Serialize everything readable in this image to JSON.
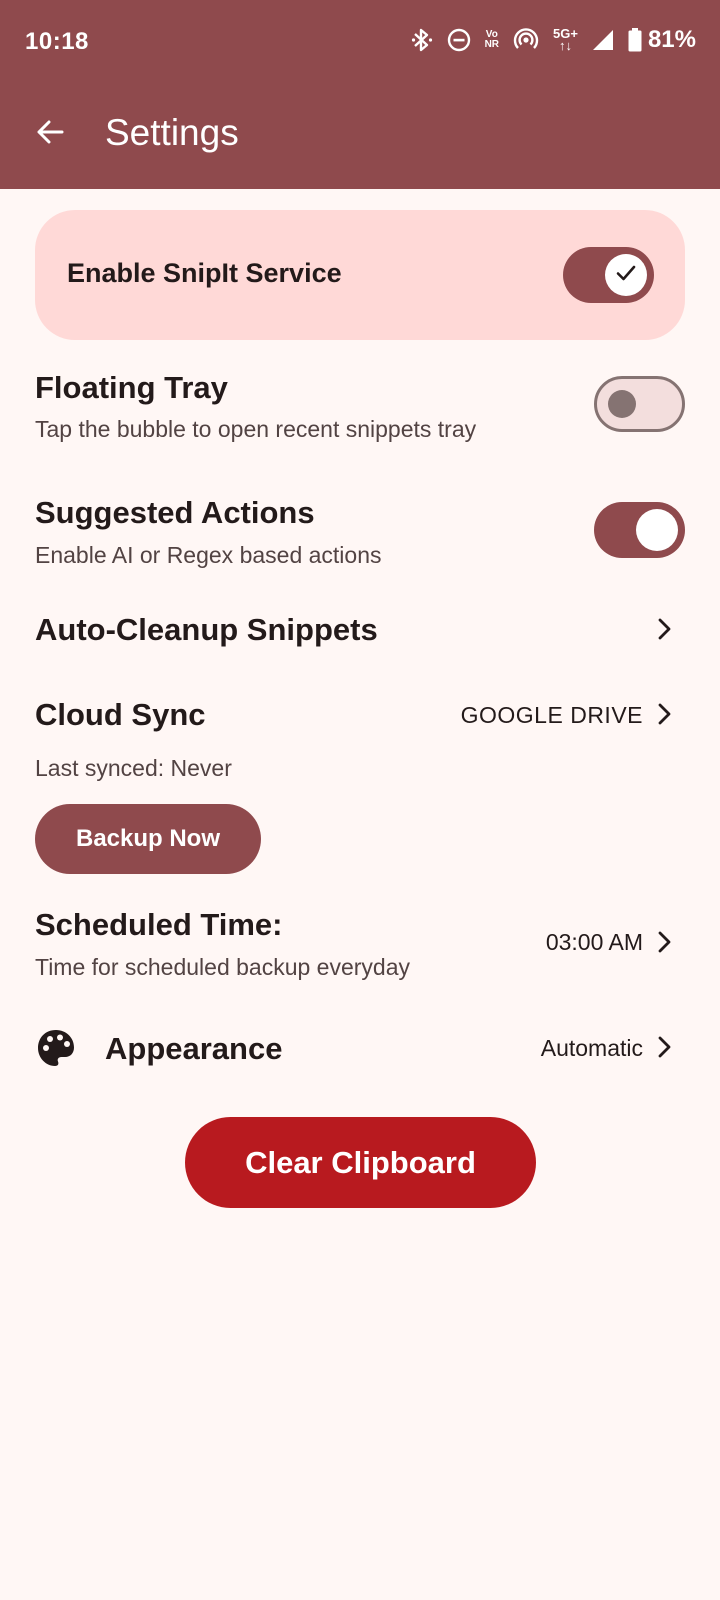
{
  "status_bar": {
    "time": "10:18",
    "volte_top": "Vo",
    "volte_bottom": "NR",
    "network_top": "5G+",
    "network_bottom": "↑↓",
    "battery": "81%",
    "battery_level": 0.81
  },
  "header": {
    "title": "Settings",
    "back_icon": "arrow-back-icon",
    "background_color": "#8f4a4d"
  },
  "enable_service": {
    "label": "Enable SnipIt Service",
    "enabled": true
  },
  "floating_tray": {
    "title": "Floating Tray",
    "subtitle": "Tap the bubble to open recent snippets tray",
    "enabled": false
  },
  "suggested_actions": {
    "title": "Suggested Actions",
    "subtitle": "Enable AI or Regex based actions",
    "enabled": true
  },
  "auto_cleanup": {
    "title": "Auto-Cleanup Snippets"
  },
  "cloud_sync": {
    "title": "Cloud Sync",
    "provider": "GOOGLE DRIVE",
    "last_synced": "Last synced: Never",
    "backup_button": "Backup Now"
  },
  "scheduled_time": {
    "title": "Scheduled Time:",
    "subtitle": "Time for scheduled backup everyday",
    "value": "03:00 AM"
  },
  "appearance": {
    "title": "Appearance",
    "value": "Automatic",
    "icon": "palette-icon"
  },
  "clear_clipboard": {
    "label": "Clear Clipboard",
    "color": "#b81a1f"
  },
  "colors": {
    "primary": "#8f4a4d",
    "surface": "#fff7f5",
    "card": "#ffd9d7"
  }
}
